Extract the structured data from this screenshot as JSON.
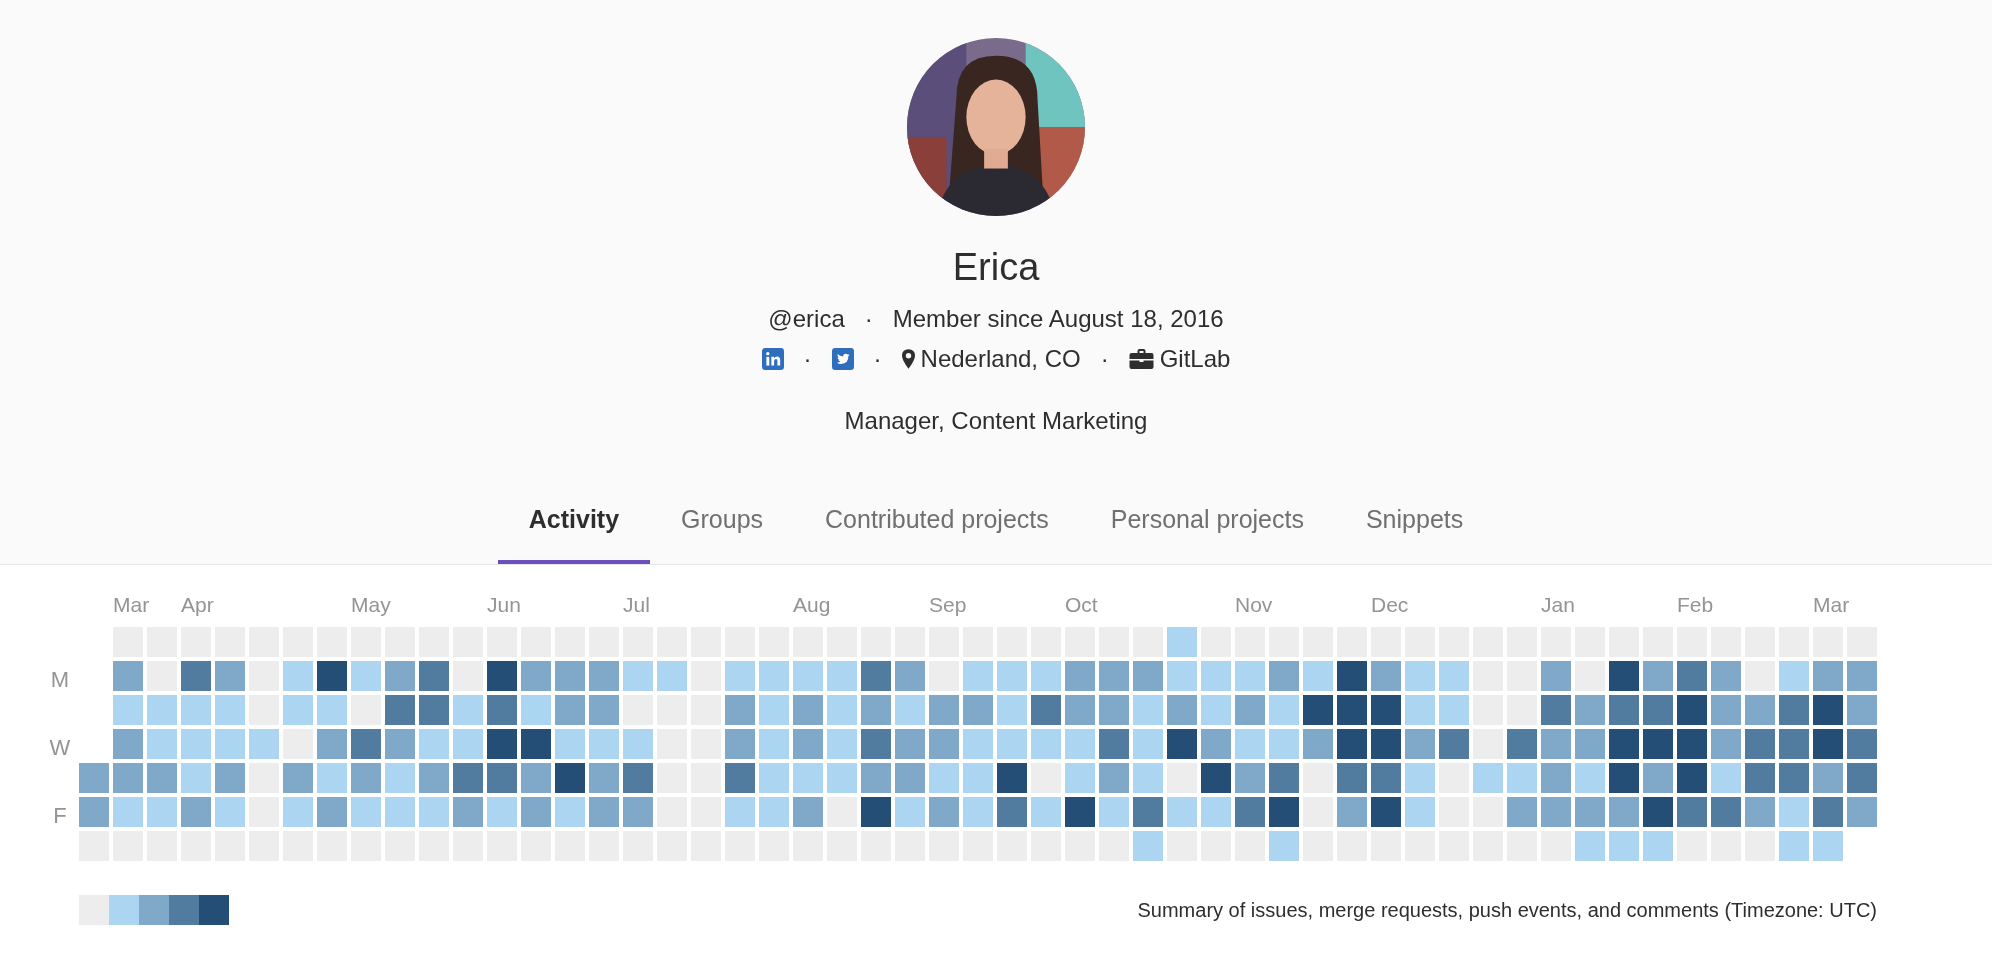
{
  "profile": {
    "name": "Erica",
    "meta": {
      "username": "@erica",
      "separator": "·",
      "member_since": "Member since August 18, 2016"
    },
    "links_line": [
      {
        "kind": "linkedin"
      },
      {
        "kind": "separator",
        "text": "·"
      },
      {
        "kind": "twitter"
      },
      {
        "kind": "separator",
        "text": "·"
      },
      {
        "kind": "location",
        "text": "Nederland, CO"
      },
      {
        "kind": "separator",
        "text": "·"
      },
      {
        "kind": "organization",
        "text": "GitLab"
      }
    ],
    "job_title": "Manager, Content Marketing"
  },
  "tabs": [
    {
      "label": "Activity",
      "selected": true
    },
    {
      "label": "Groups",
      "selected": false
    },
    {
      "label": "Contributed projects",
      "selected": false
    },
    {
      "label": "Personal projects",
      "selected": false
    },
    {
      "label": "Snippets",
      "selected": false
    }
  ],
  "calendar": {
    "day_labels": [
      "M",
      "W",
      "F"
    ],
    "weeks": [
      {
        "days": [
          {
            "color": "#7fa8c9"
          },
          {
            "color": "#7fa8c9"
          },
          {
            "color": "#ededed"
          }
        ]
      },
      {
        "month": "Mar",
        "days": [
          {
            "color": "#ededed"
          },
          {
            "color": "#7fa8c9"
          },
          {
            "color": "#acd5f2"
          },
          {
            "color": "#7fa8c9"
          },
          {
            "color": "#7fa8c9"
          },
          {
            "color": "#acd5f2"
          },
          {
            "color": "#ededed"
          }
        ]
      },
      {
        "days": [
          {
            "color": "#ededed"
          },
          {
            "color": "#ededed"
          },
          {
            "color": "#acd5f2"
          },
          {
            "color": "#acd5f2"
          },
          {
            "color": "#7fa8c9"
          },
          {
            "color": "#acd5f2"
          },
          {
            "color": "#ededed"
          }
        ]
      },
      {
        "month": "Apr",
        "days": [
          {
            "color": "#ededed"
          },
          {
            "color": "#527ba0"
          },
          {
            "color": "#acd5f2"
          },
          {
            "color": "#acd5f2"
          },
          {
            "color": "#acd5f2"
          },
          {
            "color": "#7fa8c9"
          },
          {
            "color": "#ededed"
          }
        ]
      },
      {
        "days": [
          {
            "color": "#ededed"
          },
          {
            "color": "#7fa8c9"
          },
          {
            "color": "#acd5f2"
          },
          {
            "color": "#acd5f2"
          },
          {
            "color": "#7fa8c9"
          },
          {
            "color": "#acd5f2"
          },
          {
            "color": "#ededed"
          }
        ]
      },
      {
        "days": [
          {
            "color": "#ededed"
          },
          {
            "color": "#ededed"
          },
          {
            "color": "#ededed"
          },
          {
            "color": "#acd5f2"
          },
          {
            "color": "#ededed"
          },
          {
            "color": "#ededed"
          },
          {
            "color": "#ededed"
          }
        ]
      },
      {
        "days": [
          {
            "color": "#ededed"
          },
          {
            "color": "#acd5f2"
          },
          {
            "color": "#acd5f2"
          },
          {
            "color": "#ededed"
          },
          {
            "color": "#7fa8c9"
          },
          {
            "color": "#acd5f2"
          },
          {
            "color": "#ededed"
          }
        ]
      },
      {
        "days": [
          {
            "color": "#ededed"
          },
          {
            "color": "#254e77"
          },
          {
            "color": "#acd5f2"
          },
          {
            "color": "#7fa8c9"
          },
          {
            "color": "#acd5f2"
          },
          {
            "color": "#7fa8c9"
          },
          {
            "color": "#ededed"
          }
        ]
      },
      {
        "month": "May",
        "days": [
          {
            "color": "#ededed"
          },
          {
            "color": "#acd5f2"
          },
          {
            "color": "#ededed"
          },
          {
            "color": "#527ba0"
          },
          {
            "color": "#7fa8c9"
          },
          {
            "color": "#acd5f2"
          },
          {
            "color": "#ededed"
          }
        ]
      },
      {
        "days": [
          {
            "color": "#ededed"
          },
          {
            "color": "#7fa8c9"
          },
          {
            "color": "#527ba0"
          },
          {
            "color": "#7fa8c9"
          },
          {
            "color": "#acd5f2"
          },
          {
            "color": "#acd5f2"
          },
          {
            "color": "#ededed"
          }
        ]
      },
      {
        "days": [
          {
            "color": "#ededed"
          },
          {
            "color": "#527ba0"
          },
          {
            "color": "#527ba0"
          },
          {
            "color": "#acd5f2"
          },
          {
            "color": "#7fa8c9"
          },
          {
            "color": "#acd5f2"
          },
          {
            "color": "#ededed"
          }
        ]
      },
      {
        "days": [
          {
            "color": "#ededed"
          },
          {
            "color": "#ededed"
          },
          {
            "color": "#acd5f2"
          },
          {
            "color": "#acd5f2"
          },
          {
            "color": "#527ba0"
          },
          {
            "color": "#7fa8c9"
          },
          {
            "color": "#ededed"
          }
        ]
      },
      {
        "month": "Jun",
        "days": [
          {
            "color": "#ededed"
          },
          {
            "color": "#254e77"
          },
          {
            "color": "#527ba0"
          },
          {
            "color": "#254e77"
          },
          {
            "color": "#527ba0"
          },
          {
            "color": "#acd5f2"
          },
          {
            "color": "#ededed"
          }
        ]
      },
      {
        "days": [
          {
            "color": "#ededed"
          },
          {
            "color": "#7fa8c9"
          },
          {
            "color": "#acd5f2"
          },
          {
            "color": "#254e77"
          },
          {
            "color": "#7fa8c9"
          },
          {
            "color": "#7fa8c9"
          },
          {
            "color": "#ededed"
          }
        ]
      },
      {
        "days": [
          {
            "color": "#ededed"
          },
          {
            "color": "#7fa8c9"
          },
          {
            "color": "#7fa8c9"
          },
          {
            "color": "#acd5f2"
          },
          {
            "color": "#254e77"
          },
          {
            "color": "#acd5f2"
          },
          {
            "color": "#ededed"
          }
        ]
      },
      {
        "days": [
          {
            "color": "#ededed"
          },
          {
            "color": "#7fa8c9"
          },
          {
            "color": "#7fa8c9"
          },
          {
            "color": "#acd5f2"
          },
          {
            "color": "#7fa8c9"
          },
          {
            "color": "#7fa8c9"
          },
          {
            "color": "#ededed"
          }
        ]
      },
      {
        "month": "Jul",
        "days": [
          {
            "color": "#ededed"
          },
          {
            "color": "#acd5f2"
          },
          {
            "color": "#ededed"
          },
          {
            "color": "#acd5f2"
          },
          {
            "color": "#527ba0"
          },
          {
            "color": "#7fa8c9"
          },
          {
            "color": "#ededed"
          }
        ]
      },
      {
        "days": [
          {
            "color": "#ededed"
          },
          {
            "color": "#acd5f2"
          },
          {
            "color": "#ededed"
          },
          {
            "color": "#ededed"
          },
          {
            "color": "#ededed"
          },
          {
            "color": "#ededed"
          },
          {
            "color": "#ededed"
          }
        ]
      },
      {
        "days": [
          {
            "color": "#ededed"
          },
          {
            "color": "#ededed"
          },
          {
            "color": "#ededed"
          },
          {
            "color": "#ededed"
          },
          {
            "color": "#ededed"
          },
          {
            "color": "#ededed"
          },
          {
            "color": "#ededed"
          }
        ]
      },
      {
        "days": [
          {
            "color": "#ededed"
          },
          {
            "color": "#acd5f2"
          },
          {
            "color": "#7fa8c9"
          },
          {
            "color": "#7fa8c9"
          },
          {
            "color": "#527ba0"
          },
          {
            "color": "#acd5f2"
          },
          {
            "color": "#ededed"
          }
        ]
      },
      {
        "days": [
          {
            "color": "#ededed"
          },
          {
            "color": "#acd5f2"
          },
          {
            "color": "#acd5f2"
          },
          {
            "color": "#acd5f2"
          },
          {
            "color": "#acd5f2"
          },
          {
            "color": "#acd5f2"
          },
          {
            "color": "#ededed"
          }
        ]
      },
      {
        "month": "Aug",
        "days": [
          {
            "color": "#ededed"
          },
          {
            "color": "#acd5f2"
          },
          {
            "color": "#7fa8c9"
          },
          {
            "color": "#7fa8c9"
          },
          {
            "color": "#acd5f2"
          },
          {
            "color": "#7fa8c9"
          },
          {
            "color": "#ededed"
          }
        ]
      },
      {
        "days": [
          {
            "color": "#ededed"
          },
          {
            "color": "#acd5f2"
          },
          {
            "color": "#acd5f2"
          },
          {
            "color": "#acd5f2"
          },
          {
            "color": "#acd5f2"
          },
          {
            "color": "#ededed"
          },
          {
            "color": "#ededed"
          }
        ]
      },
      {
        "days": [
          {
            "color": "#ededed"
          },
          {
            "color": "#527ba0"
          },
          {
            "color": "#7fa8c9"
          },
          {
            "color": "#527ba0"
          },
          {
            "color": "#7fa8c9"
          },
          {
            "color": "#254e77"
          },
          {
            "color": "#ededed"
          }
        ]
      },
      {
        "days": [
          {
            "color": "#ededed"
          },
          {
            "color": "#7fa8c9"
          },
          {
            "color": "#acd5f2"
          },
          {
            "color": "#7fa8c9"
          },
          {
            "color": "#7fa8c9"
          },
          {
            "color": "#acd5f2"
          },
          {
            "color": "#ededed"
          }
        ]
      },
      {
        "month": "Sep",
        "days": [
          {
            "color": "#ededed"
          },
          {
            "color": "#ededed"
          },
          {
            "color": "#7fa8c9"
          },
          {
            "color": "#7fa8c9"
          },
          {
            "color": "#acd5f2"
          },
          {
            "color": "#7fa8c9"
          },
          {
            "color": "#ededed"
          }
        ]
      },
      {
        "days": [
          {
            "color": "#ededed"
          },
          {
            "color": "#acd5f2"
          },
          {
            "color": "#7fa8c9"
          },
          {
            "color": "#acd5f2"
          },
          {
            "color": "#acd5f2"
          },
          {
            "color": "#acd5f2"
          },
          {
            "color": "#ededed"
          }
        ]
      },
      {
        "days": [
          {
            "color": "#ededed"
          },
          {
            "color": "#acd5f2"
          },
          {
            "color": "#acd5f2"
          },
          {
            "color": "#acd5f2"
          },
          {
            "color": "#254e77"
          },
          {
            "color": "#527ba0"
          },
          {
            "color": "#ededed"
          }
        ]
      },
      {
        "days": [
          {
            "color": "#ededed"
          },
          {
            "color": "#acd5f2"
          },
          {
            "color": "#527ba0"
          },
          {
            "color": "#acd5f2"
          },
          {
            "color": "#ededed"
          },
          {
            "color": "#acd5f2"
          },
          {
            "color": "#ededed"
          }
        ]
      },
      {
        "month": "Oct",
        "days": [
          {
            "color": "#ededed"
          },
          {
            "color": "#7fa8c9"
          },
          {
            "color": "#7fa8c9"
          },
          {
            "color": "#acd5f2"
          },
          {
            "color": "#acd5f2"
          },
          {
            "color": "#254e77"
          },
          {
            "color": "#ededed"
          }
        ]
      },
      {
        "days": [
          {
            "color": "#ededed"
          },
          {
            "color": "#7fa8c9"
          },
          {
            "color": "#7fa8c9"
          },
          {
            "color": "#527ba0"
          },
          {
            "color": "#7fa8c9"
          },
          {
            "color": "#acd5f2"
          },
          {
            "color": "#ededed"
          }
        ]
      },
      {
        "days": [
          {
            "color": "#ededed"
          },
          {
            "color": "#7fa8c9"
          },
          {
            "color": "#acd5f2"
          },
          {
            "color": "#acd5f2"
          },
          {
            "color": "#acd5f2"
          },
          {
            "color": "#527ba0"
          },
          {
            "color": "#acd5f2"
          }
        ]
      },
      {
        "days": [
          {
            "color": "#acd5f2"
          },
          {
            "color": "#acd5f2"
          },
          {
            "color": "#7fa8c9"
          },
          {
            "color": "#254e77"
          },
          {
            "color": "#ededed"
          },
          {
            "color": "#acd5f2"
          },
          {
            "color": "#ededed"
          }
        ]
      },
      {
        "days": [
          {
            "color": "#ededed"
          },
          {
            "color": "#acd5f2"
          },
          {
            "color": "#acd5f2"
          },
          {
            "color": "#7fa8c9"
          },
          {
            "color": "#254e77"
          },
          {
            "color": "#acd5f2"
          },
          {
            "color": "#ededed"
          }
        ]
      },
      {
        "month": "Nov",
        "days": [
          {
            "color": "#ededed"
          },
          {
            "color": "#acd5f2"
          },
          {
            "color": "#7fa8c9"
          },
          {
            "color": "#acd5f2"
          },
          {
            "color": "#7fa8c9"
          },
          {
            "color": "#527ba0"
          },
          {
            "color": "#ededed"
          }
        ]
      },
      {
        "days": [
          {
            "color": "#ededed"
          },
          {
            "color": "#7fa8c9"
          },
          {
            "color": "#acd5f2"
          },
          {
            "color": "#acd5f2"
          },
          {
            "color": "#527ba0"
          },
          {
            "color": "#254e77"
          },
          {
            "color": "#acd5f2"
          }
        ]
      },
      {
        "days": [
          {
            "color": "#ededed"
          },
          {
            "color": "#acd5f2"
          },
          {
            "color": "#254e77"
          },
          {
            "color": "#7fa8c9"
          },
          {
            "color": "#ededed"
          },
          {
            "color": "#ededed"
          },
          {
            "color": "#ededed"
          }
        ]
      },
      {
        "days": [
          {
            "color": "#ededed"
          },
          {
            "color": "#254e77"
          },
          {
            "color": "#254e77"
          },
          {
            "color": "#254e77"
          },
          {
            "color": "#527ba0"
          },
          {
            "color": "#7fa8c9"
          },
          {
            "color": "#ededed"
          }
        ]
      },
      {
        "month": "Dec",
        "days": [
          {
            "color": "#ededed"
          },
          {
            "color": "#7fa8c9"
          },
          {
            "color": "#254e77"
          },
          {
            "color": "#254e77"
          },
          {
            "color": "#527ba0"
          },
          {
            "color": "#254e77"
          },
          {
            "color": "#ededed"
          }
        ]
      },
      {
        "days": [
          {
            "color": "#ededed"
          },
          {
            "color": "#acd5f2"
          },
          {
            "color": "#acd5f2"
          },
          {
            "color": "#7fa8c9"
          },
          {
            "color": "#acd5f2"
          },
          {
            "color": "#acd5f2"
          },
          {
            "color": "#ededed"
          }
        ]
      },
      {
        "days": [
          {
            "color": "#ededed"
          },
          {
            "color": "#acd5f2"
          },
          {
            "color": "#acd5f2"
          },
          {
            "color": "#527ba0"
          },
          {
            "color": "#ededed"
          },
          {
            "color": "#ededed"
          },
          {
            "color": "#ededed"
          }
        ]
      },
      {
        "days": [
          {
            "color": "#ededed"
          },
          {
            "color": "#ededed"
          },
          {
            "color": "#ededed"
          },
          {
            "color": "#ededed"
          },
          {
            "color": "#acd5f2"
          },
          {
            "color": "#ededed"
          },
          {
            "color": "#ededed"
          }
        ]
      },
      {
        "days": [
          {
            "color": "#ededed"
          },
          {
            "color": "#ededed"
          },
          {
            "color": "#ededed"
          },
          {
            "color": "#527ba0"
          },
          {
            "color": "#acd5f2"
          },
          {
            "color": "#7fa8c9"
          },
          {
            "color": "#ededed"
          }
        ]
      },
      {
        "month": "Jan",
        "days": [
          {
            "color": "#ededed"
          },
          {
            "color": "#7fa8c9"
          },
          {
            "color": "#527ba0"
          },
          {
            "color": "#7fa8c9"
          },
          {
            "color": "#7fa8c9"
          },
          {
            "color": "#7fa8c9"
          },
          {
            "color": "#ededed"
          }
        ]
      },
      {
        "days": [
          {
            "color": "#ededed"
          },
          {
            "color": "#ededed"
          },
          {
            "color": "#7fa8c9"
          },
          {
            "color": "#7fa8c9"
          },
          {
            "color": "#acd5f2"
          },
          {
            "color": "#7fa8c9"
          },
          {
            "color": "#acd5f2"
          }
        ]
      },
      {
        "days": [
          {
            "color": "#ededed"
          },
          {
            "color": "#254e77"
          },
          {
            "color": "#527ba0"
          },
          {
            "color": "#254e77"
          },
          {
            "color": "#254e77"
          },
          {
            "color": "#7fa8c9"
          },
          {
            "color": "#acd5f2"
          }
        ]
      },
      {
        "days": [
          {
            "color": "#ededed"
          },
          {
            "color": "#7fa8c9"
          },
          {
            "color": "#527ba0"
          },
          {
            "color": "#254e77"
          },
          {
            "color": "#7fa8c9"
          },
          {
            "color": "#254e77"
          },
          {
            "color": "#acd5f2"
          }
        ]
      },
      {
        "month": "Feb",
        "days": [
          {
            "color": "#ededed"
          },
          {
            "color": "#527ba0"
          },
          {
            "color": "#254e77"
          },
          {
            "color": "#254e77"
          },
          {
            "color": "#254e77"
          },
          {
            "color": "#527ba0"
          },
          {
            "color": "#ededed"
          }
        ]
      },
      {
        "days": [
          {
            "color": "#ededed"
          },
          {
            "color": "#7fa8c9"
          },
          {
            "color": "#7fa8c9"
          },
          {
            "color": "#7fa8c9"
          },
          {
            "color": "#acd5f2"
          },
          {
            "color": "#527ba0"
          },
          {
            "color": "#ededed"
          }
        ]
      },
      {
        "days": [
          {
            "color": "#ededed"
          },
          {
            "color": "#ededed"
          },
          {
            "color": "#7fa8c9"
          },
          {
            "color": "#527ba0"
          },
          {
            "color": "#527ba0"
          },
          {
            "color": "#7fa8c9"
          },
          {
            "color": "#ededed"
          }
        ]
      },
      {
        "days": [
          {
            "color": "#ededed"
          },
          {
            "color": "#acd5f2"
          },
          {
            "color": "#527ba0"
          },
          {
            "color": "#527ba0"
          },
          {
            "color": "#527ba0"
          },
          {
            "color": "#acd5f2"
          },
          {
            "color": "#acd5f2"
          }
        ]
      },
      {
        "month": "Mar",
        "days": [
          {
            "color": "#ededed"
          },
          {
            "color": "#7fa8c9"
          },
          {
            "color": "#254e77"
          },
          {
            "color": "#254e77"
          },
          {
            "color": "#7fa8c9"
          },
          {
            "color": "#527ba0"
          },
          {
            "color": "#acd5f2"
          }
        ]
      },
      {
        "days": [
          {
            "color": "#ededed"
          },
          {
            "color": "#7fa8c9"
          },
          {
            "color": "#7fa8c9"
          },
          {
            "color": "#527ba0"
          },
          {
            "color": "#527ba0"
          },
          {
            "color": "#7fa8c9"
          }
        ]
      }
    ],
    "legend": [
      {
        "color": "#ededed"
      },
      {
        "color": "#acd5f2"
      },
      {
        "color": "#7fa8c9"
      },
      {
        "color": "#527ba0"
      },
      {
        "color": "#254e77"
      }
    ],
    "summary": "Summary of issues, merge requests, push events, and comments (Timezone: UTC)"
  }
}
